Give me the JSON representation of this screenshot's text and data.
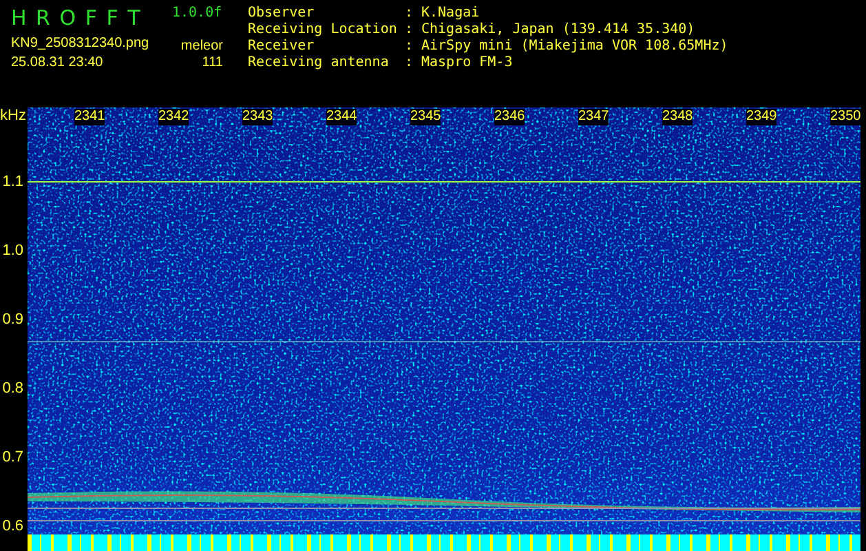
{
  "app": {
    "name": "H R O F F T",
    "version": "1.0.0f",
    "filename": "KN9_2508312340.png",
    "date_time": "25.08.31 23:40",
    "mode_label": "meleor",
    "count": "111"
  },
  "station_info": [
    {
      "label": "Observer",
      "separator": ":",
      "value": "K.Nagai"
    },
    {
      "label": "Receiving Location",
      "separator": ":",
      "value": "Chigasaki, Japan (139.414 35.340)"
    },
    {
      "label": "Receiver",
      "separator": ":",
      "value": "AirSpy mini (Miakejima VOR 108.65MHz)"
    },
    {
      "label": "Receiving antenna",
      "separator": ":",
      "value": "Maspro FM-3"
    }
  ],
  "spectrogram": {
    "y_unit": "kHz",
    "y_labels": [
      "1.1",
      "1.0",
      "0.9",
      "0.8",
      "0.7",
      "0.6"
    ],
    "x_labels": [
      "2341",
      "2342",
      "2343",
      "2344",
      "2345",
      "2346",
      "2347",
      "2348",
      "2349",
      "2350"
    ]
  }
}
